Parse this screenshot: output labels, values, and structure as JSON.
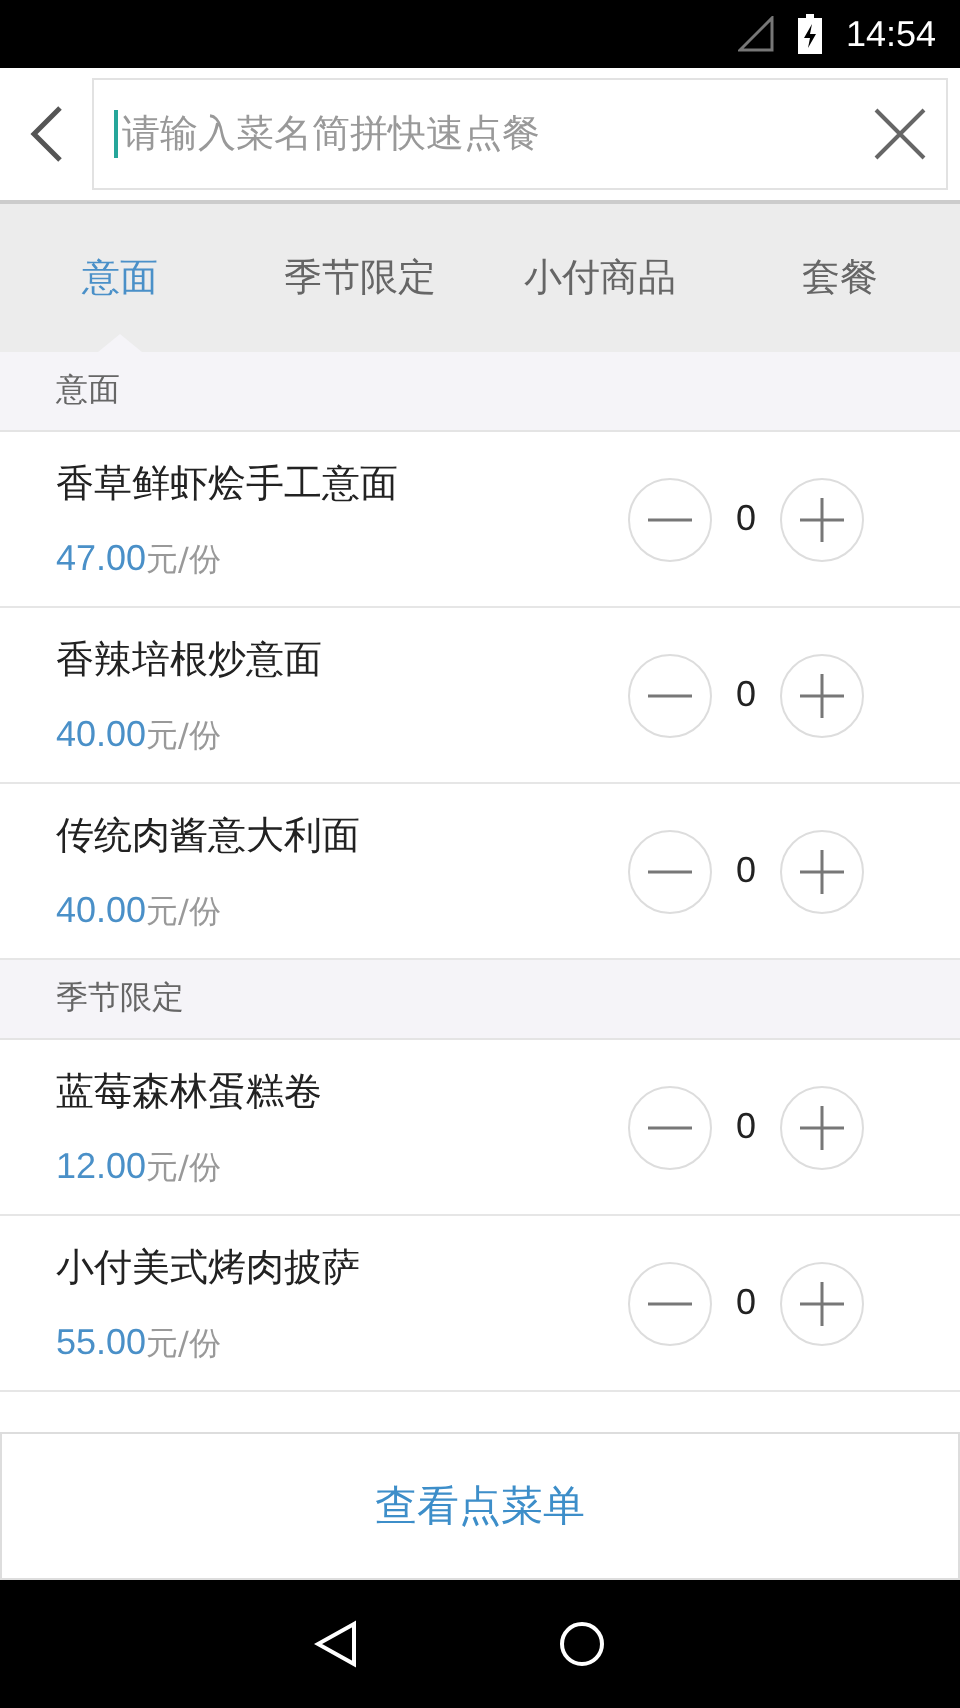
{
  "status_bar": {
    "time": "14:54"
  },
  "search": {
    "placeholder": "请输入菜名简拼快速点餐"
  },
  "tabs": [
    {
      "label": "意面",
      "selected": true
    },
    {
      "label": "季节限定",
      "selected": false
    },
    {
      "label": "小付商品",
      "selected": false
    },
    {
      "label": "套餐",
      "selected": false
    }
  ],
  "sections": [
    {
      "title": "意面",
      "items": [
        {
          "name": "香草鲜虾烩手工意面",
          "price": "47.00",
          "unit": "元/份",
          "quantity": "0"
        },
        {
          "name": "香辣培根炒意面",
          "price": "40.00",
          "unit": "元/份",
          "quantity": "0"
        },
        {
          "name": "传统肉酱意大利面",
          "price": "40.00",
          "unit": "元/份",
          "quantity": "0"
        }
      ]
    },
    {
      "title": "季节限定",
      "items": [
        {
          "name": "蓝莓森林蛋糕卷",
          "price": "12.00",
          "unit": "元/份",
          "quantity": "0"
        },
        {
          "name": "小付美式烤肉披萨",
          "price": "55.00",
          "unit": "元/份",
          "quantity": "0"
        }
      ]
    }
  ],
  "bottom_button": "查看点菜单"
}
